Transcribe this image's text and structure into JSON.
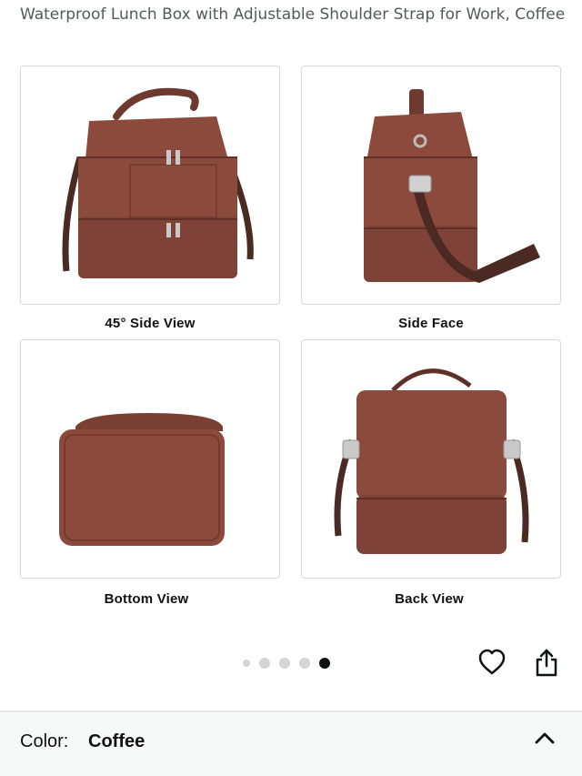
{
  "product": {
    "title": "Waterproof Lunch Box with Adjustable Shoulder Strap for Work, Coffee"
  },
  "gallery": {
    "captions": [
      "45° Side  View",
      "Side  Face",
      "Bottom View",
      "Back View"
    ],
    "page_count": 5,
    "active_index": 4
  },
  "actions": {
    "favorite_icon": "heart-icon",
    "share_icon": "share-icon"
  },
  "variation": {
    "label": "Color:",
    "value": "Coffee",
    "toggle_icon": "chevron-up-icon"
  },
  "colors": {
    "bag": "#8b4a3c",
    "bag_dark": "#6e3a30",
    "strap": "#4a2a22"
  }
}
